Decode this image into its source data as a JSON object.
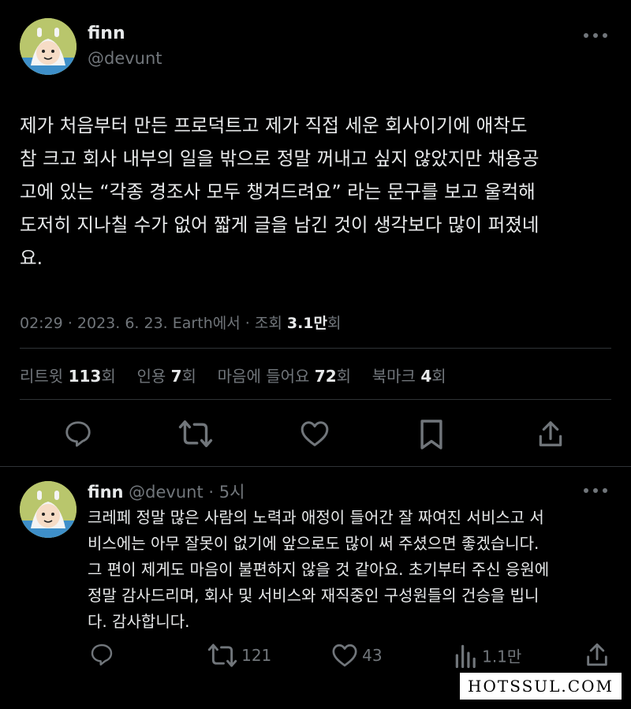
{
  "main_tweet": {
    "display_name": "finn",
    "handle": "@devunt",
    "body": "제가 처음부터 만든 프로덕트고 제가 직접 세운 회사이기에 애착도\n참 크고 회사 내부의 일을 밖으로 정말 꺼내고 싶지 않았지만 채용공\n고에 있는 “각종 경조사 모두 챙겨드려요” 라는 문구를 보고 울컥해\n도저히 지나칠 수가 없어 짧게 글을 남긴 것이 생각보다 많이 퍼졌네\n요.",
    "meta": {
      "time": "02:29",
      "date": "2023. 6. 23.",
      "source": "Earth에서",
      "views_label": "조회",
      "views_value": "3.1만",
      "views_suffix": "회"
    },
    "stats": [
      {
        "label": "리트윗",
        "value": "113",
        "suffix": "회"
      },
      {
        "label": "인용",
        "value": "7",
        "suffix": "회"
      },
      {
        "label": "마음에 들어요",
        "value": "72",
        "suffix": "회"
      },
      {
        "label": "북마크",
        "value": "4",
        "suffix": "회"
      }
    ]
  },
  "reply": {
    "display_name": "finn",
    "handle": "@devunt",
    "time_ago": "5시",
    "body": "크레페 정말 많은 사람의 노력과 애정이 들어간 잘 짜여진 서비스고 서\n비스에는 아무 잘못이 없기에 앞으로도 많이 써 주셨으면 좋겠습니다.\n그 편이 제게도 마음이 불편하지 않을 것 같아요. 초기부터 주신 응원에\n정말 감사드리며, 회사 및 서비스와 재직중인 구성원들의 건승을 빕니\n다. 감사합니다.",
    "retweets": "121",
    "likes": "43",
    "views": "1.1만"
  },
  "watermark": "HOTSSUL.COM",
  "colors": {
    "background": "#000000",
    "text": "#e7e9ea",
    "secondary": "#71767b",
    "divider": "#2f3336"
  }
}
